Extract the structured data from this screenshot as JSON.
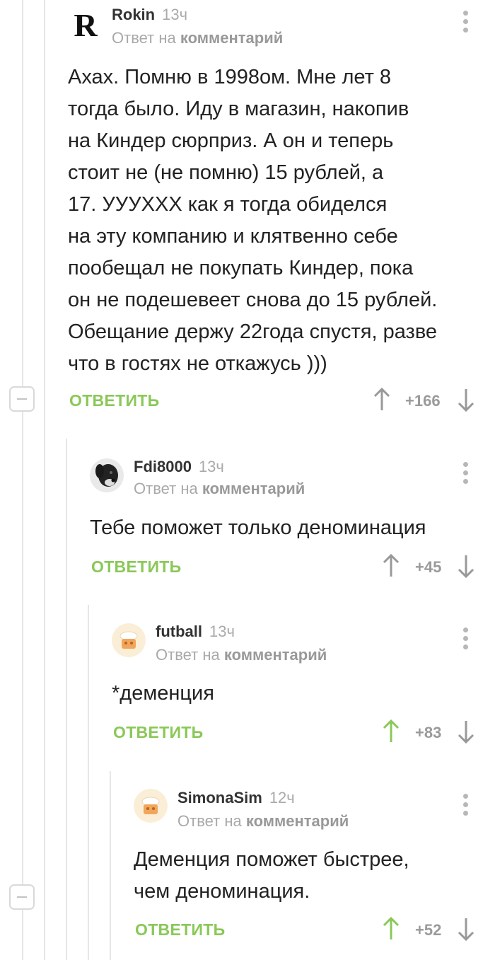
{
  "comments": [
    {
      "author": "Rokin",
      "time": "13ч",
      "reply_prefix": "Ответ на",
      "reply_link": "комментарий",
      "avatar_letter": "R",
      "text_lines": [
        "Ахах. Помню в 1998ом. Мне лет 8",
        "тогда было. Иду в магазин, накопив",
        "на Киндер сюрприз. А он и теперь",
        "стоит не (не помню) 15 рублей, а",
        "17. УУУХХХ как я тогда обиделся",
        "на эту компанию и клятвенно себе",
        "пообещал не покупать Киндер, пока",
        "он не подешевеет снова до 15 рублей.",
        "Обещание держу 22года спустя, разве",
        "что в гостях не откажусь )))"
      ],
      "reply_label": "ОТВЕТИТЬ",
      "score": "+166",
      "upvoted": false
    },
    {
      "author": "Fdi8000",
      "time": "13ч",
      "reply_prefix": "Ответ на",
      "reply_link": "комментарий",
      "text_lines": [
        "Тебе поможет только деноминация"
      ],
      "reply_label": "ОТВЕТИТЬ",
      "score": "+45",
      "upvoted": false
    },
    {
      "author": "futball",
      "time": "13ч",
      "reply_prefix": "Ответ на",
      "reply_link": "комментарий",
      "text_lines": [
        "*деменция"
      ],
      "reply_label": "ОТВЕТИТЬ",
      "score": "+83",
      "upvoted": true
    },
    {
      "author": "SimonaSim",
      "time": "12ч",
      "reply_prefix": "Ответ на",
      "reply_link": "комментарий",
      "text_lines": [
        "Деменция поможет быстрее,",
        "чем деноминация."
      ],
      "reply_label": "ОТВЕТИТЬ",
      "score": "+52",
      "upvoted": true
    }
  ],
  "colors": {
    "accent_green": "#8ac858",
    "vote_gray": "#9a9a9a",
    "thread_line": "#e6e6e6"
  }
}
